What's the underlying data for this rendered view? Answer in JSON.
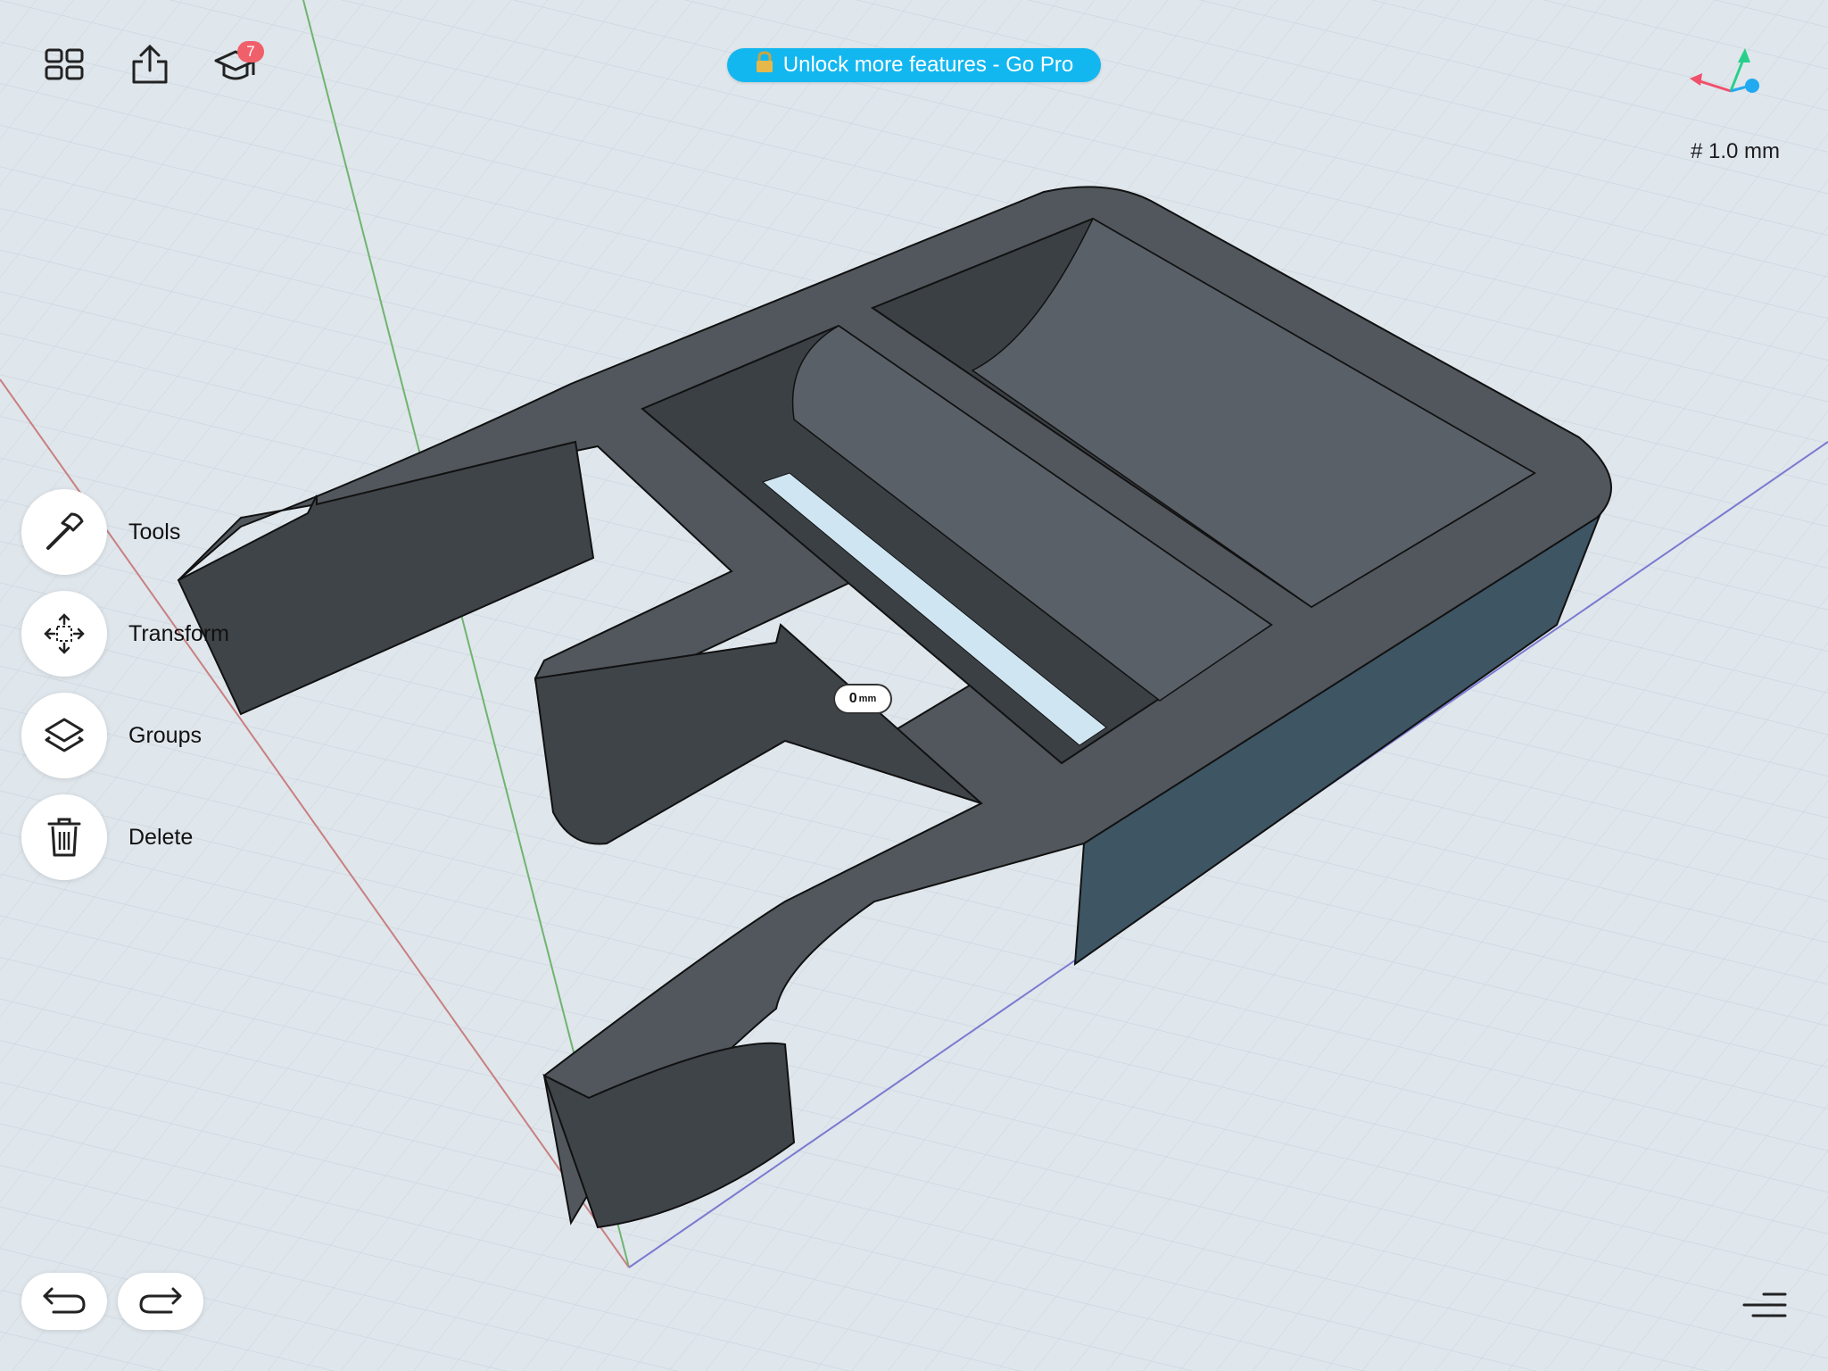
{
  "toolbar": {
    "badge_count": "7",
    "promo_label": "Unlock more features - Go Pro"
  },
  "viewport": {
    "grid_size": "# 1.0 mm",
    "dimension_value": "0",
    "dimension_unit": "mm"
  },
  "side_menu": {
    "tools": "Tools",
    "transform": "Transform",
    "groups": "Groups",
    "delete": "Delete"
  },
  "colors": {
    "accent": "#13b7f0",
    "badge": "#f0606a",
    "model": "#4e555b",
    "model_side": "#3e5563"
  }
}
